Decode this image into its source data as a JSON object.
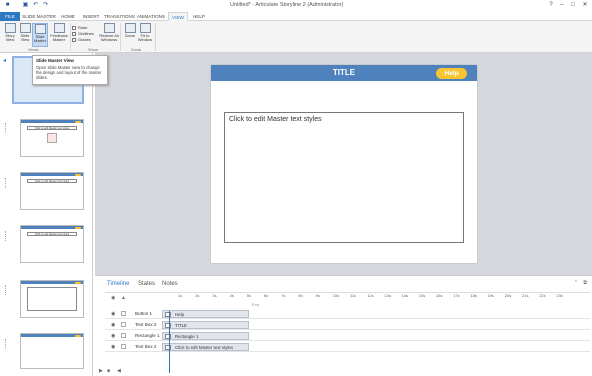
{
  "app": {
    "window_title": "Untitled* - Articulate Storyline 2 (Administrator)",
    "window_controls": [
      "?",
      "–",
      "□",
      "✕"
    ]
  },
  "quick_access": [
    "save-icon",
    "undo-icon",
    "redo-icon"
  ],
  "tabs": [
    "FILE",
    "SLIDE MASTER",
    "HOME",
    "INSERT",
    "TRANSITIONS",
    "ANIMATIONS",
    "VIEW",
    "HELP"
  ],
  "ribbon": {
    "buttons": [
      {
        "label": "Story\nView",
        "icon": "story-view-icon"
      },
      {
        "label": "Slide\nView",
        "icon": "slide-view-icon"
      },
      {
        "label": "Slide\nMaster",
        "icon": "slide-master-icon"
      },
      {
        "label": "Feedback\nMaster",
        "icon": "feedback-master-icon"
      }
    ],
    "views_group": "Views",
    "show_options": [
      "Ruler",
      "Gridlines",
      "Guides"
    ],
    "show_group": "Show",
    "windows_button": "Restore All\nWindows",
    "zoom_buttons": [
      "Zoom",
      "Fit to\nWindow"
    ],
    "zoom_group": "Zoom"
  },
  "tooltip": {
    "title": "Slide Master View",
    "description": "Open Slide Master view to change the design and layout of the master slides."
  },
  "thumbnails": {
    "body_text": "Click to edit Master text styles"
  },
  "slide": {
    "title": "TITLE",
    "help_button": "Help",
    "body_text": "Click to edit Master text styles",
    "colors": {
      "header": "#4f81bd",
      "help": "#f7c531"
    }
  },
  "timeline": {
    "tabs": [
      "Timeline",
      "States",
      "Notes"
    ],
    "ruler": [
      "1s",
      "2s",
      "3s",
      "4s",
      "5s",
      "6s",
      "7s",
      "8s",
      "9s",
      "10s",
      "11s",
      "12s",
      "13s",
      "14s",
      "15s",
      "16s",
      "17s",
      "18s",
      "19s",
      "20s",
      "21s",
      "22s",
      "23s"
    ],
    "rows": [
      {
        "name": "Button 1",
        "bar": "Help"
      },
      {
        "name": "Text Box 2",
        "bar": "TITLE"
      },
      {
        "name": "Rectangle 1",
        "bar": "Rectangle 1"
      },
      {
        "name": "Text Box 2",
        "bar": "Click to edit Master text styles"
      }
    ],
    "end_label": "End"
  }
}
